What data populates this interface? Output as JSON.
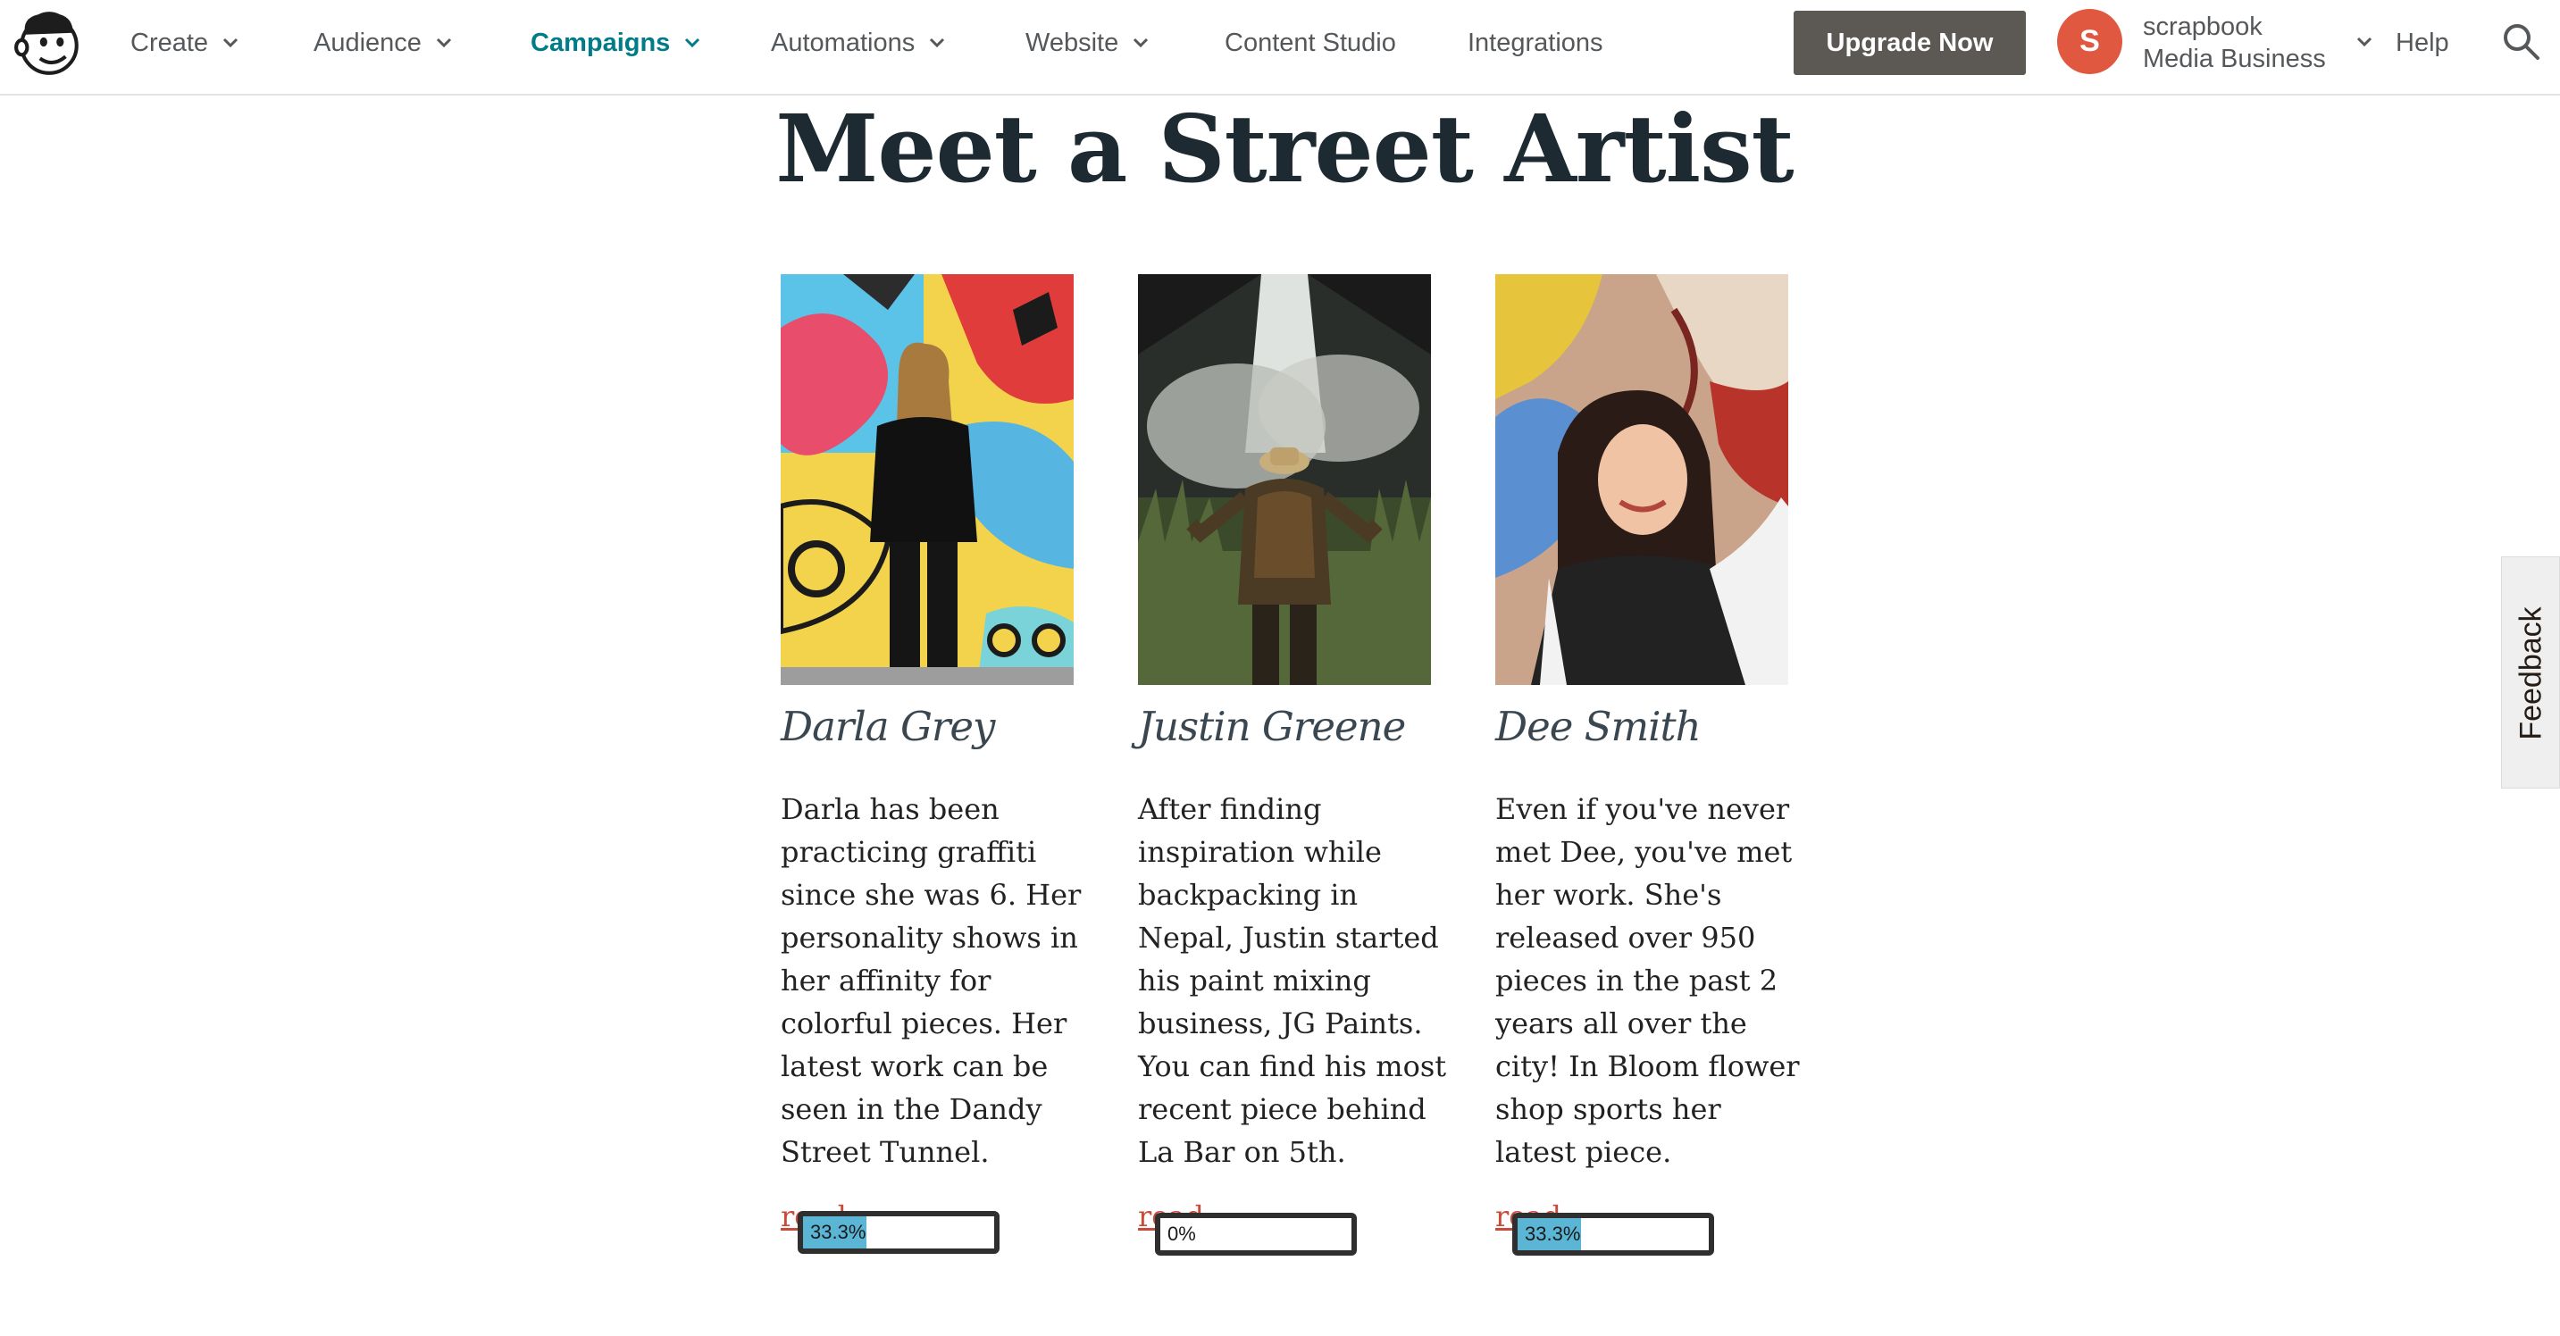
{
  "nav": {
    "items": [
      {
        "label": "Create",
        "has_dropdown": true,
        "active": false
      },
      {
        "label": "Audience",
        "has_dropdown": true,
        "active": false
      },
      {
        "label": "Campaigns",
        "has_dropdown": true,
        "active": true
      },
      {
        "label": "Automations",
        "has_dropdown": true,
        "active": false
      },
      {
        "label": "Website",
        "has_dropdown": true,
        "active": false
      },
      {
        "label": "Content Studio",
        "has_dropdown": false,
        "active": false
      },
      {
        "label": "Integrations",
        "has_dropdown": false,
        "active": false
      }
    ],
    "upgrade_label": "Upgrade Now",
    "account": {
      "initial": "S",
      "name_line1": "scrapbook",
      "name_line2": "Media Business"
    },
    "help_label": "Help",
    "icons": {
      "logo": "mailchimp-freddie-icon",
      "search": "search-icon",
      "dropdown": "chevron-down-icon"
    },
    "colors": {
      "active": "#007c89",
      "upgrade_bg": "#5c5954",
      "avatar_bg": "#e0583f"
    }
  },
  "page": {
    "title": "Meet a Street Artist",
    "artists": [
      {
        "name": "Darla Grey",
        "bio": "Darla has been practicing graffiti since she was 6. Her personality shows in her affinity for colorful pieces. Her latest work can be seen in the Dandy Street Tunnel.",
        "link_label": "read",
        "progress_label": "33.3%",
        "progress": 0.333
      },
      {
        "name": "Justin Greene",
        "bio": "After finding inspiration while backpacking in Nepal, Justin started his paint mixing business, JG Paints. You can find his most recent piece behind La Bar on 5th.",
        "link_label": "read",
        "progress_label": "0%",
        "progress": 0
      },
      {
        "name": "Dee Smith",
        "bio": "Even if you've never met Dee, you've met her work. She's released over 950 pieces in the past 2 years all over the city! In Bloom flower shop sports her latest piece.",
        "link_label": "read",
        "progress_label": "33.3%",
        "progress": 0.333
      }
    ]
  },
  "feedback_label": "Feedback"
}
